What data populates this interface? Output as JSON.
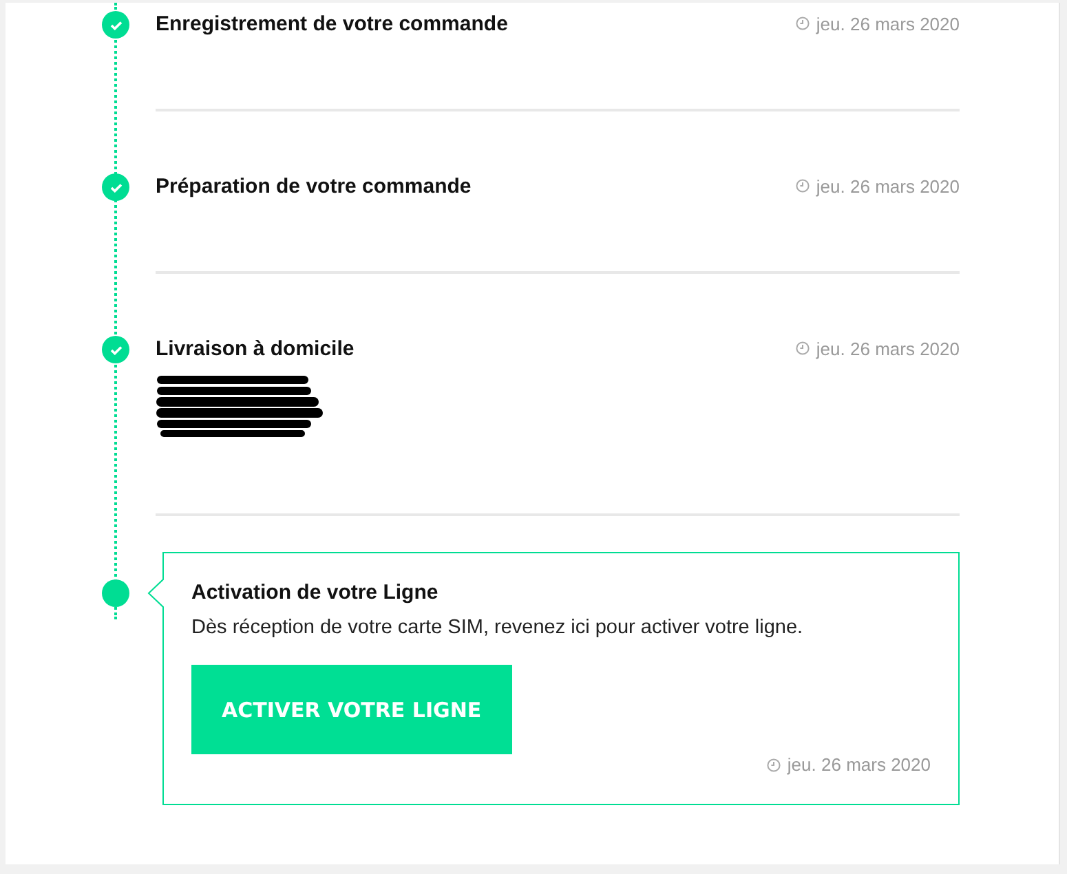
{
  "steps": [
    {
      "kind": "row",
      "title": "Enregistrement de votre commande",
      "date": "jeu. 26 mars 2020",
      "completed": true
    },
    {
      "kind": "row",
      "title": "Préparation de votre commande",
      "date": "jeu. 26 mars 2020",
      "completed": true
    },
    {
      "kind": "row",
      "title": "Livraison à domicile",
      "date": "jeu. 26 mars 2020",
      "completed": true,
      "redacted": true
    },
    {
      "kind": "card",
      "title": "Activation de votre Ligne",
      "description": "Dès réception de votre carte SIM, revenez ici pour activer votre ligne.",
      "button": "ACTIVER VOTRE LIGNE",
      "date": "jeu. 26 mars 2020",
      "completed": false
    }
  ]
}
